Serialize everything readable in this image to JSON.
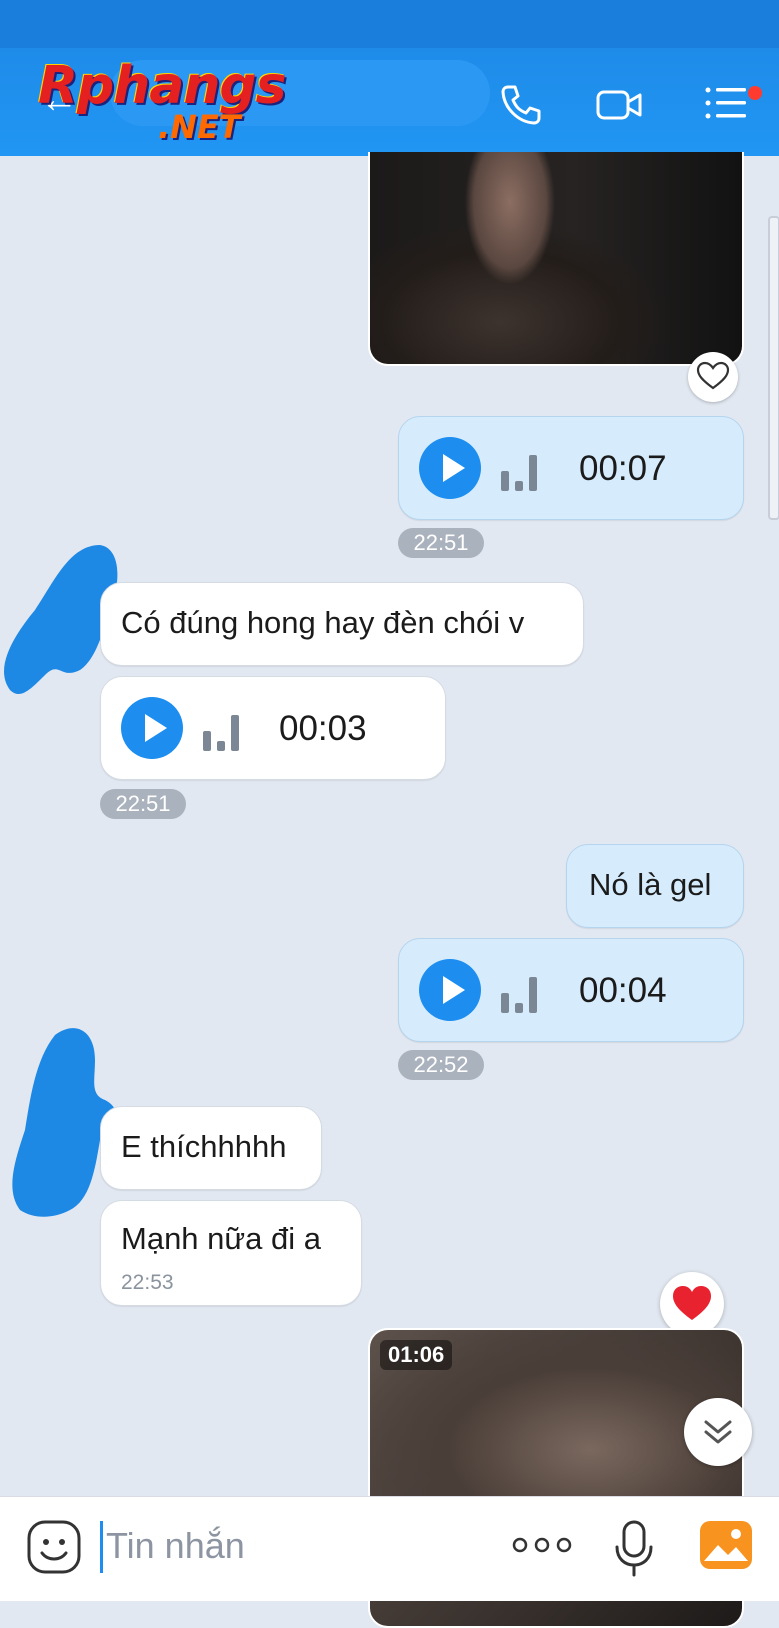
{
  "header": {
    "back_icon": "arrow-left-icon",
    "watermark_line1": "Rphangs",
    "watermark_line2": ".NET",
    "contact_name": "",
    "icons": [
      "phone-icon",
      "video-camera-icon",
      "menu-list-icon"
    ],
    "notification_dot_color": "#ff3b30"
  },
  "messages": {
    "m1_voice_duration": "00:07",
    "m1_time": "22:51",
    "m2_text": "Có đúng hong hay đèn chói v",
    "m3_voice_duration": "00:03",
    "m3_time": "22:51",
    "m4_text": "Nó là gel",
    "m5_voice_duration": "00:04",
    "m5_time": "22:52",
    "m6_text": "E thíchhhhh",
    "m7_text": "Mạnh nữa đi a",
    "m7_time": "22:53",
    "m8_video_duration": "01:06"
  },
  "input": {
    "placeholder": "Tin nhắn",
    "icons": [
      "emoji-icon",
      "more-icon",
      "microphone-icon",
      "gallery-icon"
    ]
  },
  "colors": {
    "accent": "#1d8ef0",
    "outgoing_bubble": "#d6ecfd",
    "incoming_bubble": "#ffffff",
    "chat_background": "#e2e8f1",
    "header": "#2196f3"
  }
}
